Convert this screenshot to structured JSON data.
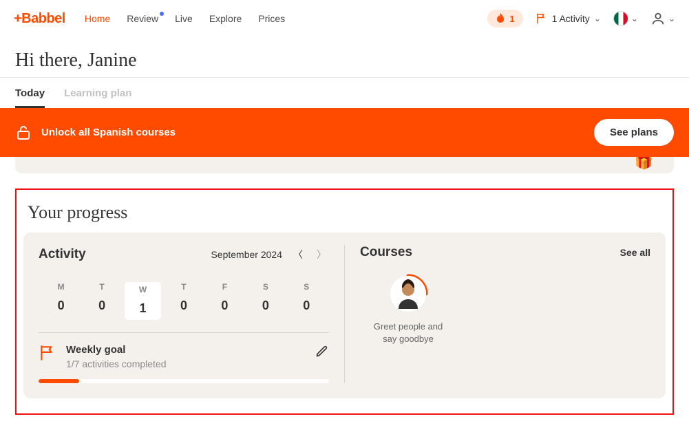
{
  "nav": {
    "logo": "+Babbel",
    "links": {
      "home": "Home",
      "review": "Review",
      "live": "Live",
      "explore": "Explore",
      "prices": "Prices"
    },
    "streak_count": "1",
    "activity_label": "1 Activity"
  },
  "greeting": "Hi there, Janine",
  "tabs": {
    "today": "Today",
    "plan": "Learning plan"
  },
  "banner": {
    "text": "Unlock all Spanish courses",
    "cta": "See plans"
  },
  "progress": {
    "title": "Your progress",
    "activity": {
      "heading": "Activity",
      "month": "September 2024",
      "days": [
        {
          "label": "M",
          "count": "0"
        },
        {
          "label": "T",
          "count": "0"
        },
        {
          "label": "W",
          "count": "1"
        },
        {
          "label": "T",
          "count": "0"
        },
        {
          "label": "F",
          "count": "0"
        },
        {
          "label": "S",
          "count": "0"
        },
        {
          "label": "S",
          "count": "0"
        }
      ],
      "goal_title": "Weekly goal",
      "goal_sub": "1/7 activities completed",
      "goal_pct": 14
    },
    "courses": {
      "heading": "Courses",
      "see_all": "See all",
      "item_label": "Greet people and say goodbye",
      "item_pct": 25
    }
  }
}
